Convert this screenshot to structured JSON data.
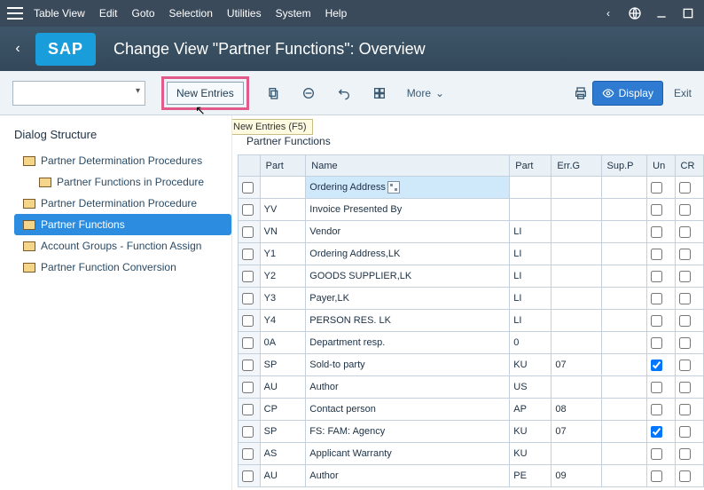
{
  "menubar": {
    "items": [
      "Table View",
      "Edit",
      "Goto",
      "Selection",
      "Utilities",
      "System",
      "Help"
    ]
  },
  "titlebar": {
    "title": "Change View \"Partner Functions\": Overview",
    "logo": "SAP"
  },
  "toolbar": {
    "new_entries": "New Entries",
    "tooltip": "New Entries   (F5)",
    "more": "More",
    "display": "Display",
    "exit": "Exit"
  },
  "tree": {
    "title": "Dialog Structure",
    "items": [
      {
        "label": "Partner Determination Procedures",
        "indent": 1
      },
      {
        "label": "Partner Functions in Procedure",
        "indent": 2
      },
      {
        "label": "Partner Determination Procedure",
        "indent": 1
      },
      {
        "label": "Partner Functions",
        "indent": 1,
        "active": true
      },
      {
        "label": "Account Groups - Function Assign",
        "indent": 1
      },
      {
        "label": "Partner Function Conversion",
        "indent": 1
      }
    ]
  },
  "table": {
    "section": "Partner Functions",
    "headers": [
      "Part",
      "Name",
      "Part",
      "Err.G",
      "Sup.P",
      "Un",
      "CR"
    ],
    "rows": [
      {
        "c1": "",
        "c2": "Ordering Address",
        "sel": true,
        "c3": "",
        "c4": "",
        "c5": ""
      },
      {
        "c1": "YV",
        "c2": "Invoice Presented By",
        "c3": "",
        "c4": "",
        "c5": ""
      },
      {
        "c1": "VN",
        "c2": "Vendor",
        "c3": "LI",
        "c4": "",
        "c5": ""
      },
      {
        "c1": "Y1",
        "c2": "Ordering Address,LK",
        "c3": "LI",
        "c4": "",
        "c5": ""
      },
      {
        "c1": "Y2",
        "c2": "GOODS SUPPLIER,LK",
        "c3": "LI",
        "c4": "",
        "c5": ""
      },
      {
        "c1": "Y3",
        "c2": "Payer,LK",
        "c3": "LI",
        "c4": "",
        "c5": ""
      },
      {
        "c1": "Y4",
        "c2": "PERSON RES. LK",
        "c3": "LI",
        "c4": "",
        "c5": ""
      },
      {
        "c1": "0A",
        "c2": "Department resp.",
        "c3": "0",
        "c4": "",
        "c5": ""
      },
      {
        "c1": "SP",
        "c2": "Sold-to party",
        "c3": "KU",
        "c4": "07",
        "c5": "",
        "unchk": true
      },
      {
        "c1": "AU",
        "c2": "Author",
        "c3": "US",
        "c4": "",
        "c5": ""
      },
      {
        "c1": "CP",
        "c2": "Contact person",
        "c3": "AP",
        "c4": "08",
        "c5": ""
      },
      {
        "c1": "SP",
        "c2": "FS: FAM: Agency",
        "c3": "KU",
        "c4": "07",
        "c5": "",
        "unchk": true
      },
      {
        "c1": "AS",
        "c2": "Applicant Warranty",
        "c3": "KU",
        "c4": "",
        "c5": ""
      },
      {
        "c1": "AU",
        "c2": "Author",
        "c3": "PE",
        "c4": "09",
        "c5": ""
      }
    ]
  }
}
